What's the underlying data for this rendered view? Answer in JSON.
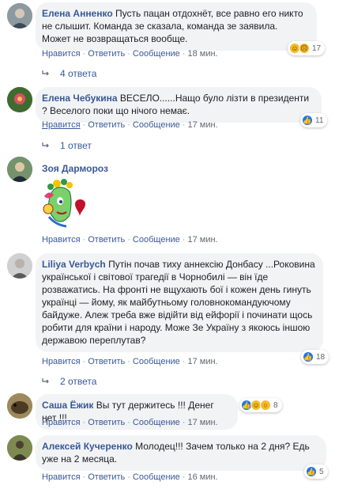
{
  "labels": {
    "like": "Нравится",
    "reply": "Ответить",
    "message": "Сообщение",
    "dot": "·"
  },
  "comments": [
    {
      "author": "Елена Анненко",
      "text": "Пусть пацан отдохнёт, все равно его никто не слышит. Команда зе сказала, команда зе заявила. Может не возвращаться вообще.",
      "time": "18 мин.",
      "reactions": [
        "haha",
        "sad"
      ],
      "reaction_count": "17",
      "replies": "4 ответа"
    },
    {
      "author": "Елена Чебукина",
      "text": "ВЕСЕЛО......Нащо було лізти в президенти ? Веселого поки що нічого немає.",
      "time": "17 мин.",
      "reactions": [
        "like"
      ],
      "reaction_count": "11",
      "replies": "1 ответ"
    },
    {
      "author": "Зоя Дармороз",
      "text": "",
      "time": "17 мин."
    },
    {
      "author": "Liliya Verbych",
      "text": "Путін почав тиху аннексію Донбасу ...Роковина української і світової трагедії в Чорнобилі — він їде розважатись. На фронті не вщухають бої і кожен день гинуть українці — йому, як майбутньому головнокомандуючому байдуже. Алеж треба вже відійти від ейфорії і починати щось робити для країни і народу. Може Зе Україну з якоюсь іншою державою переплутав?",
      "time": "17 мин.",
      "reactions": [
        "like"
      ],
      "reaction_count": "18",
      "replies": "2 ответа"
    },
    {
      "author": "Саша Ёжик",
      "text": "Вы тут держитесь !!! Денег нет !!!",
      "time": "17 мин.",
      "reactions": [
        "like",
        "haha",
        "wow"
      ],
      "reaction_count": "8"
    },
    {
      "author": "Алексей Кучеренко",
      "text": "Молодец!!! Зачем только на 2 дня? Едь уже на 2 месяца.",
      "time": "16 мин.",
      "reactions": [
        "like"
      ],
      "reaction_count": "5"
    }
  ]
}
